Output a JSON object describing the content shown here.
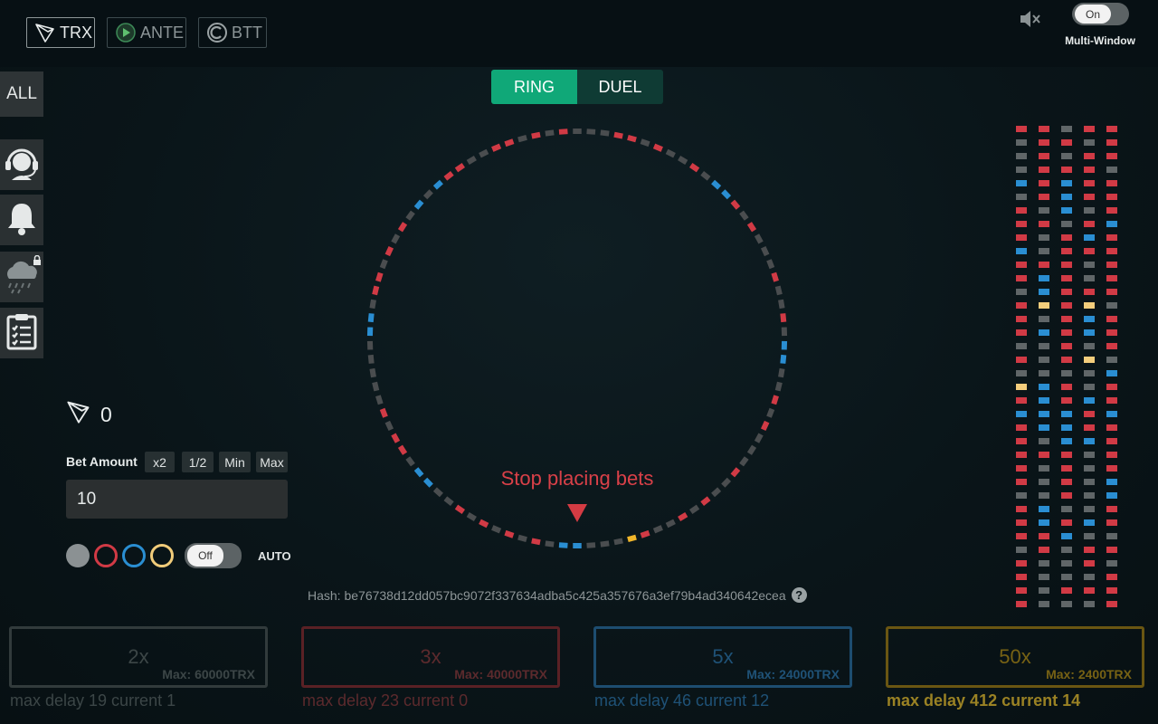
{
  "coins": [
    {
      "label": "TRX",
      "icon": "tron-logo-icon",
      "active": true
    },
    {
      "label": "ANTE",
      "icon": "ante-logo-icon",
      "active": false
    },
    {
      "label": "BTT",
      "icon": "btt-logo-icon",
      "active": false
    }
  ],
  "header": {
    "multi_window_label": "Multi-Window",
    "multi_window_toggle": "On"
  },
  "sidebar": {
    "all_label": "ALL",
    "items": [
      "support-icon",
      "bell-icon",
      "rain-icon",
      "clipboard-icon"
    ]
  },
  "modes": {
    "ring": "RING",
    "duel": "DUEL"
  },
  "game": {
    "status_text": "Stop placing bets",
    "colors": {
      "gray": "#4a4d4f",
      "red": "#d13a45",
      "blue": "#2a8ed2",
      "gold": "#f1b62a",
      "pale_gold": "#f3cd7c"
    }
  },
  "ring_segments": "bbgrgrgrgrggbbgrrgrgggggbbgrrgrgrgbgbrrggrrgrgrgggrrgrggrgbbrgrgggrggrgbbggrgrgggrggrgrggryggg",
  "history": [
    "rrgrr",
    "grrgr",
    "grgrr",
    "grrrg",
    "brbrr",
    "grbrr",
    "rgbgr",
    "rrgrb",
    "rgrbr",
    "bgrrr",
    "rrrgr",
    "rbrgr",
    "gbrrr",
    "rprpg",
    "rgrbr",
    "rbrbr",
    "ggrgr",
    "rgrpg",
    "ggggb",
    "pbrgr",
    "rbrbr",
    "bbbrb",
    "rbbrr",
    "rgbbr",
    "rrrgr",
    "rgrgr",
    "rgrgb",
    "ggrgb",
    "rbggr",
    "rbrbr",
    "rrbgg",
    "grgrr",
    "rggrg",
    "rgggr",
    "rgrrr",
    "rgggr"
  ],
  "balance": {
    "value": "0"
  },
  "bet": {
    "label": "Bet Amount",
    "chips": [
      "x2",
      "1/2",
      "Min",
      "Max"
    ],
    "value": "10",
    "auto_toggle": "Off",
    "auto_label": "AUTO"
  },
  "hash": {
    "text": "Hash: be76738d12dd057bc9072f337634adba5c425a357676a3ef79b4ad340642ecea",
    "help": "?"
  },
  "payouts": [
    {
      "mult": "2x",
      "max": "Max: 60000TRX",
      "delay": "max delay 19 current 1",
      "color": "#323b3c",
      "text_color": "#3c4647"
    },
    {
      "mult": "3x",
      "max": "Max: 40000TRX",
      "delay": "max delay 23 current 0",
      "color": "#5a2125",
      "text_color": "#5c2a2d"
    },
    {
      "mult": "5x",
      "max": "Max: 24000TRX",
      "delay": "max delay 46 current 12",
      "color": "#1d4d70",
      "text_color": "#1f5277"
    },
    {
      "mult": "50x",
      "max": "Max: 2400TRX",
      "delay": "max delay 412 current 14",
      "color": "#6a5612",
      "text_color": "#776214"
    }
  ]
}
